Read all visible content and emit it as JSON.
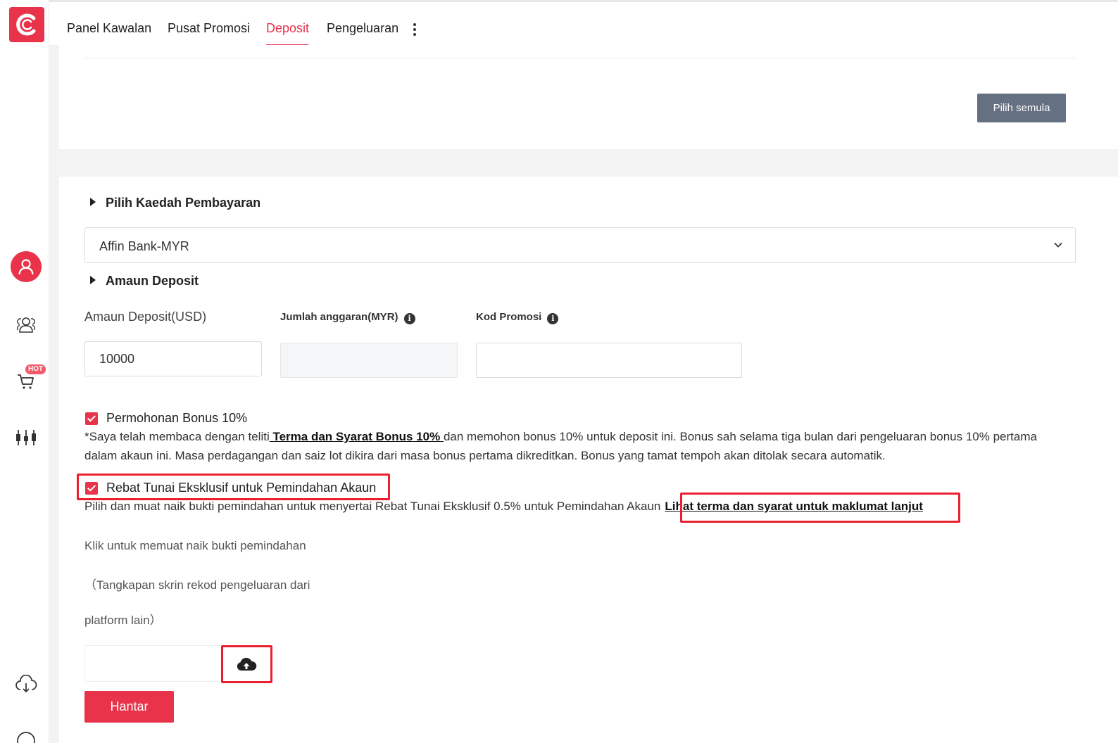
{
  "nav": {
    "items": [
      "Panel Kawalan",
      "Pusat Promosi",
      "Deposit",
      "Pengeluaran"
    ],
    "active": "Deposit"
  },
  "sidebar": {
    "hot_badge": "HOT",
    "icons": [
      "account-icon",
      "users-icon",
      "cart-icon",
      "chart-icon",
      "download-icon"
    ]
  },
  "top_card": {
    "reset_label": "Pilih semula"
  },
  "payment": {
    "title": "Pilih Kaedah Pembayaran",
    "selected": "Affin Bank-MYR"
  },
  "amount": {
    "title": "Amaun Deposit",
    "deposit_label": "Amaun Deposit(USD)",
    "deposit_value": "10000",
    "estimate_label": "Jumlah anggaran(MYR)",
    "estimate_value": "",
    "promo_label": "Kod Promosi",
    "promo_value": ""
  },
  "bonus": {
    "label": "Permohonan Bonus 10%",
    "checked": true,
    "text_before": "*Saya telah membaca dengan teliti",
    "link": " Terma dan Syarat Bonus 10% ",
    "text_after": "dan memohon bonus 10% untuk deposit ini. Bonus sah selama tiga bulan dari pengeluaran bonus 10% pertama dalam akaun ini. Masa perdagangan dan saiz lot dikira dari masa bonus pertama dikreditkan. Bonus yang tamat tempoh akan ditolak secara automatik."
  },
  "rebate": {
    "label": "Rebat Tunai Eksklusif untuk Pemindahan Akaun",
    "checked": true,
    "text": "Pilih dan muat naik bukti pemindahan untuk menyertai Rebat Tunai Eksklusif 0.5% untuk Pemindahan Akaun",
    "link": "Lihat terma dan syarat untuk maklumat lanjut"
  },
  "upload": {
    "line1": "Klik untuk memuat naik bukti pemindahan",
    "line2": "（Tangkapan skrin rekod pengeluaran dari",
    "line3": "platform lain）"
  },
  "submit_label": "Hantar",
  "colors": {
    "accent": "#e8334a",
    "reset_button": "#667083",
    "highlight_box": "#e8202f"
  }
}
